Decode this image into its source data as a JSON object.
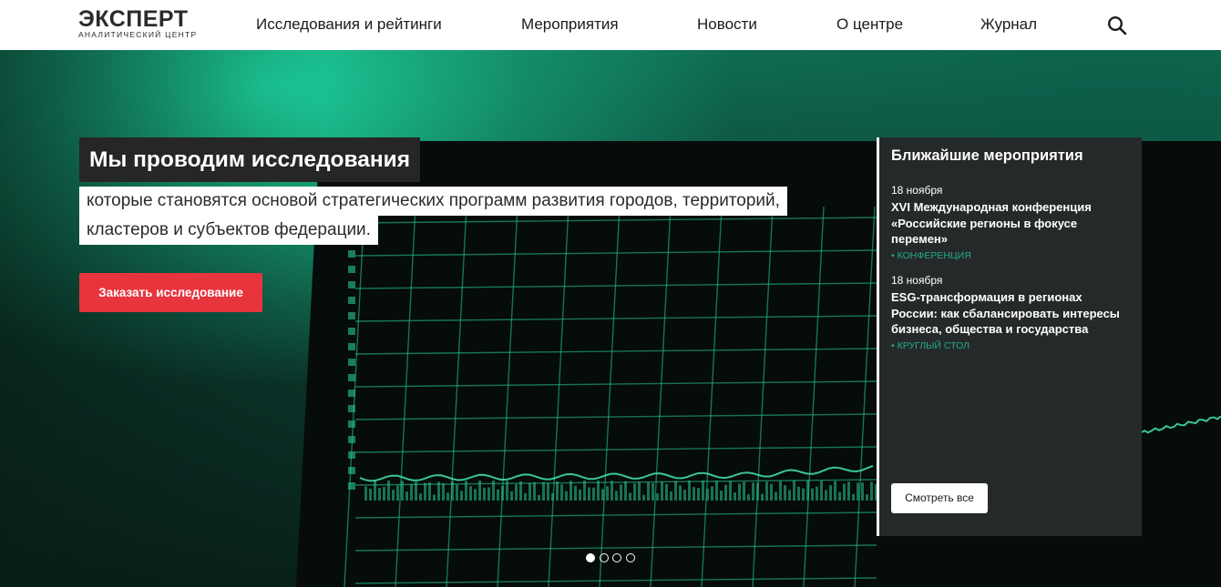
{
  "header": {
    "logo": {
      "main": "ЭКСПЕРТ",
      "sub": "АНАЛИТИЧЕСКИЙ ЦЕНТР"
    },
    "nav": [
      {
        "label": "Исследования и рейтинги"
      },
      {
        "label": "Мероприятия"
      },
      {
        "label": "Новости"
      },
      {
        "label": "О центре"
      },
      {
        "label": "Журнал"
      }
    ],
    "search_icon": "search-icon"
  },
  "hero": {
    "headline": "Мы проводим исследования",
    "lead_lines": [
      "которые становятся основой стратегических программ развития городов, территорий,",
      "кластеров и субъектов федерации."
    ],
    "cta_label": "Заказать исследование",
    "background": "trading chart on monitor",
    "colors": {
      "accent": "#e8353d",
      "green": "#1fae84",
      "panel": "#26292a"
    }
  },
  "events": {
    "title": "Ближайшие мероприятия",
    "items": [
      {
        "date": "18 ноября",
        "title": "XVI Международная конференция «Российские регионы в фокусе перемен»",
        "tag": "КОНФЕРЕНЦИЯ"
      },
      {
        "date": "18 ноября",
        "title": "ESG-трансформация в регионах России: как сбалансировать интересы бизнеса, общества и государства",
        "tag": "КРУГЛЫЙ СТОЛ"
      }
    ],
    "see_all_label": "Смотреть все"
  },
  "slider": {
    "count": 4,
    "active": 1
  }
}
